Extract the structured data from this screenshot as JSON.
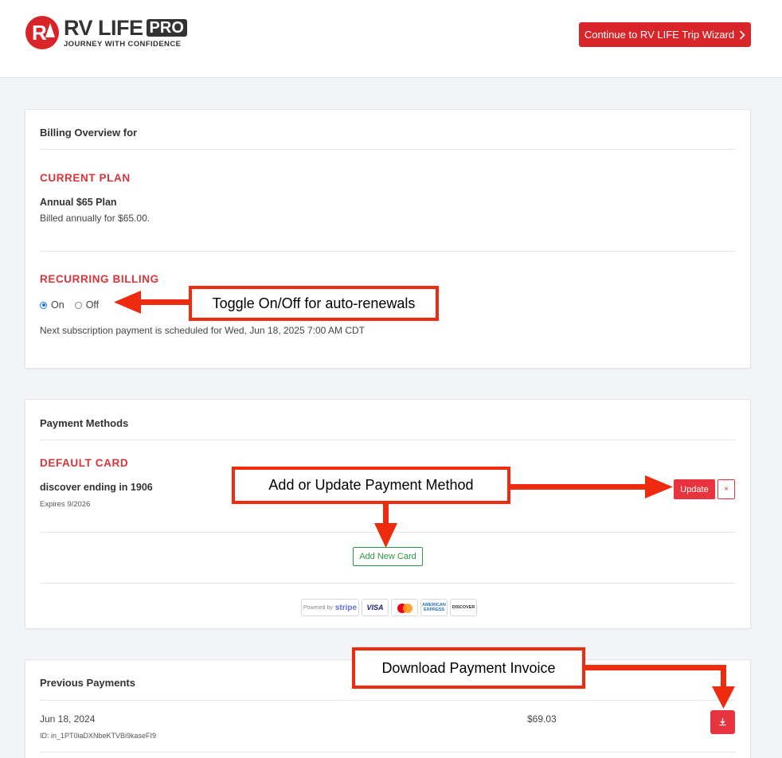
{
  "header": {
    "logo_rv": "RV LIFE",
    "logo_pro": "PRO",
    "logo_tagline": "JOURNEY WITH CONFIDENCE",
    "wizard_button": "Continue to RV LIFE Trip Wizard",
    "wizard_icon": "chevron-right-icon"
  },
  "billing": {
    "title": "Billing Overview for",
    "current_plan_label": "CURRENT PLAN",
    "plan_name": "Annual $65 Plan",
    "plan_desc": "Billed annually for $65.00.",
    "recurring_label": "RECURRING BILLING",
    "radio_on": "On",
    "radio_off": "Off",
    "selected": "On",
    "next_payment": "Next subscription payment is scheduled for Wed, Jun 18, 2025 7:00 AM CDT"
  },
  "payment_methods": {
    "title": "Payment Methods",
    "default_label": "DEFAULT CARD",
    "card_desc": "discover ending in 1906",
    "card_expires": "Expires 9/2026",
    "update_button": "Update",
    "remove_button": "×",
    "add_button": "Add New Card",
    "badges": {
      "powered": "Powered by",
      "stripe": "stripe",
      "visa": "VISA",
      "amex": "AMERICAN EXPRESS",
      "discover": "DISCOVER"
    }
  },
  "previous_payments": {
    "title": "Previous Payments",
    "rows": [
      {
        "date": "Jun 18, 2024",
        "id": "ID: in_1PT0iaDXNbeKTVBi9kaseFI9",
        "amount": "$69.03"
      }
    ],
    "download_icon": "download-icon"
  },
  "annotations": {
    "toggle": "Toggle On/Off for auto-renewals",
    "payment_method": "Add or Update Payment Method",
    "invoice": "Download Payment Invoice"
  },
  "colors": {
    "brand_red": "#d9252a",
    "section_red": "#d9343a",
    "callout_red": "#ee2b0e",
    "green": "#2b9a45",
    "radio_blue": "#1a73e8"
  }
}
